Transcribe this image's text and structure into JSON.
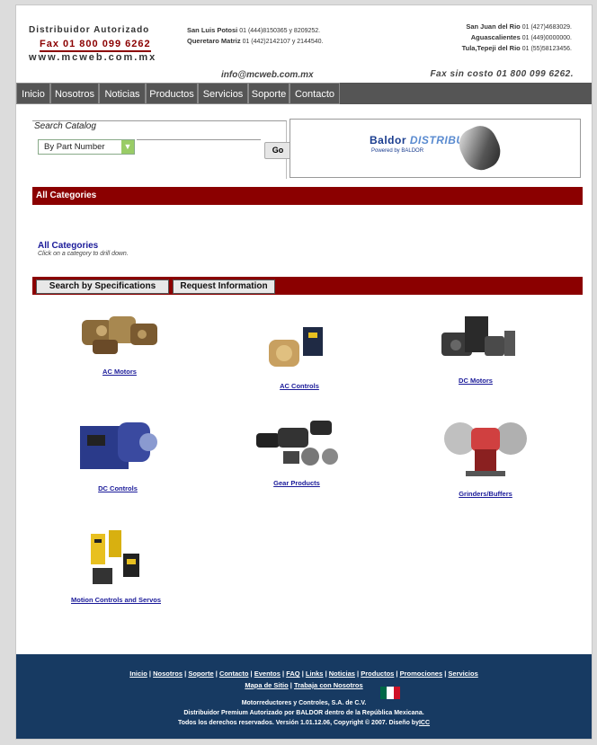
{
  "header": {
    "brand_line1": "Distribuidor Autorizado",
    "brand_line2": "Fax 01 800 099 6262",
    "brand_line3": "www.mcweb.com.mx",
    "loc1": [
      {
        "city": "San Luis Potosi",
        "phone": "01 (444)8150365 y 8209252."
      },
      {
        "city": "Queretaro Matriz",
        "phone": "01 (442)2142107 y 2144540."
      }
    ],
    "loc2": [
      {
        "city": "San Juan del Rio",
        "phone": "01 (427)4683029."
      },
      {
        "city": "Aguascalientes",
        "phone": "01 (449)0000000."
      },
      {
        "city": "Tula,Tepeji del Rio",
        "phone": "01 (55)58123456."
      }
    ],
    "email": "info@mcweb.com.mx",
    "fax": "Fax sin costo  01 800 099 6262."
  },
  "nav": [
    "Inicio",
    "Nosotros",
    "Noticias",
    "Productos",
    "Servicios",
    "Soporte",
    "Contacto"
  ],
  "catalog": {
    "title": "Search Catalog",
    "select_value": "By Part Number",
    "go_label": "Go"
  },
  "banner": {
    "brand": "Baldor",
    "brand2": "DISTRIBUTOR",
    "powered": "Powered by BALDOR"
  },
  "all_categories_bar": "All Categories",
  "all_categories": {
    "title": "All Categories",
    "subtitle": "Click on a category to drill down."
  },
  "tabs": [
    "Search by Specifications",
    "Request Information"
  ],
  "categories": [
    {
      "label": "AC Motors"
    },
    {
      "label": "AC Controls"
    },
    {
      "label": "DC Motors"
    },
    {
      "label": "DC Controls"
    },
    {
      "label": "Gear Products"
    },
    {
      "label": "Grinders/Buffers"
    },
    {
      "label": "Motion Controls and Servos"
    }
  ],
  "footer": {
    "links": [
      "Inicio",
      "Nosotros",
      "Soporte",
      "Contacto",
      "Eventos",
      "FAQ",
      "Links",
      "Noticias",
      "Productos",
      "Promociones",
      "Servicios"
    ],
    "links2": [
      "Mapa de Sitio",
      "Trabaja con Nosotros"
    ],
    "company": "Motorreductores y Controles, S.A. de C.V.",
    "line2": "Distribuidor Premium Autorizado por BALDOR dentro de la República Mexicana.",
    "line3_prefix": "Todos los derechos reservados.  Versión 1.01.12.06, Copyright © 2007.  Diseño by",
    "line3_link": "ICC"
  },
  "colors": {
    "accent": "#8b0000",
    "nav": "#555555",
    "footer": "#173a62",
    "link": "#1a1a99"
  }
}
